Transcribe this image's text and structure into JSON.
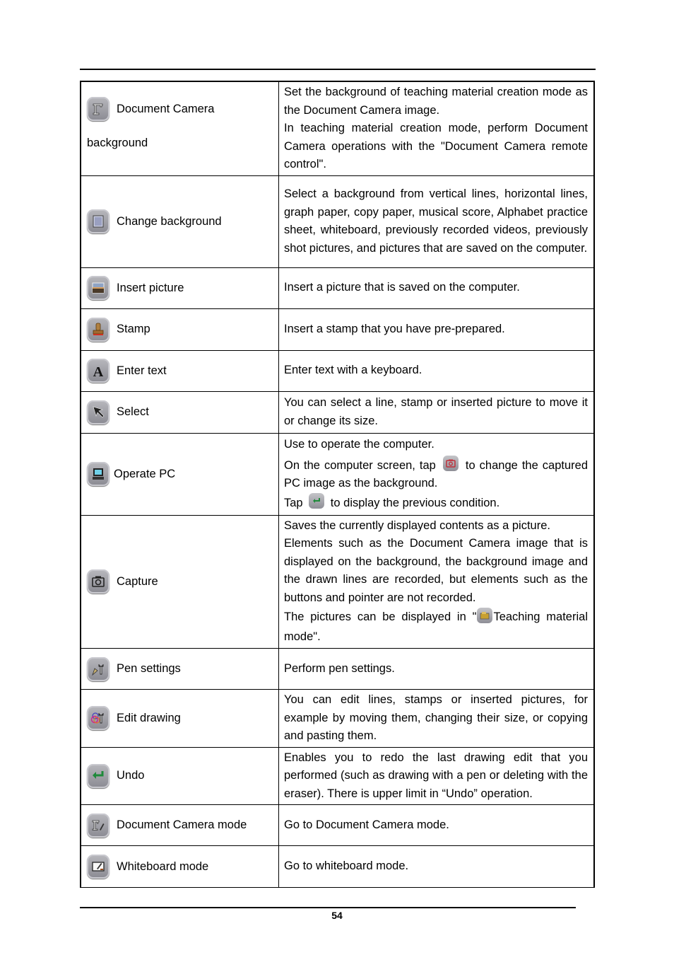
{
  "page": {
    "number": "54"
  },
  "rows": [
    {
      "icon": "document-camera-icon",
      "label": "Document Camera",
      "label_line2": "background",
      "desc": [
        "Set the background of teaching material creation mode as the Document Camera image.",
        "In teaching material creation mode, perform Document Camera operations with the \"Document Camera remote control\"."
      ]
    },
    {
      "icon": "change-background-icon",
      "label": "Change background",
      "desc": [
        "Select a background from vertical lines, horizontal lines, graph paper, copy paper, musical score, Alphabet practice sheet, whiteboard, previously recorded videos, previously shot pictures, and pictures that are saved on the computer."
      ]
    },
    {
      "icon": "insert-picture-icon",
      "label": "Insert picture",
      "desc": [
        "Insert a picture that is saved on the computer."
      ]
    },
    {
      "icon": "stamp-icon",
      "label": "Stamp",
      "desc": [
        "Insert a stamp that you have pre-prepared."
      ]
    },
    {
      "icon": "text-icon",
      "label": "Enter text",
      "desc": [
        "Enter text with a keyboard."
      ]
    },
    {
      "icon": "select-arrow-icon",
      "label": "Select",
      "desc": [
        "You can select a line, stamp or inserted picture to move it or change its size."
      ]
    },
    {
      "icon": "computer-icon",
      "label": "Operate PC",
      "desc": [
        "Use to operate the computer."
      ],
      "desc_b_pre": "On the computer screen, tap",
      "desc_b_post": "to change the captured PC image as the background.",
      "desc_c_pre": "Tap",
      "desc_c_post": "to display the previous condition."
    },
    {
      "icon": "camera-icon",
      "label": "Capture",
      "desc": [
        "Saves the currently displayed contents as a picture.",
        "Elements such as the Document Camera image that is displayed on the background, the background image and the drawn lines are recorded, but elements such as the buttons and pointer are not recorded."
      ],
      "desc_b_pre": "The pictures can be displayed in \"",
      "desc_b_post": "Teaching material mode\"."
    },
    {
      "icon": "pen-settings-icon",
      "label": "Pen settings",
      "desc": [
        "Perform pen settings."
      ]
    },
    {
      "icon": "edit-drawing-icon",
      "label": "Edit drawing",
      "desc": [
        "You can edit lines, stamps or inserted pictures, for example by moving them, changing their size, or copying and pasting them."
      ]
    },
    {
      "icon": "undo-icon",
      "label": "Undo",
      "desc": [
        "Enables you to redo the last drawing edit that you performed (such as drawing with a pen or deleting with the eraser). There is upper limit in “Undo” operation."
      ]
    },
    {
      "icon": "document-camera-mode-icon",
      "label": "Document Camera mode",
      "desc": [
        "Go to Document Camera mode."
      ]
    },
    {
      "icon": "whiteboard-mode-icon",
      "label": "Whiteboard mode",
      "desc": [
        "Go to whiteboard mode."
      ]
    }
  ],
  "colors": {
    "capture_inline_icon": "#c0303a",
    "undo_green": "#1f8a3a"
  }
}
